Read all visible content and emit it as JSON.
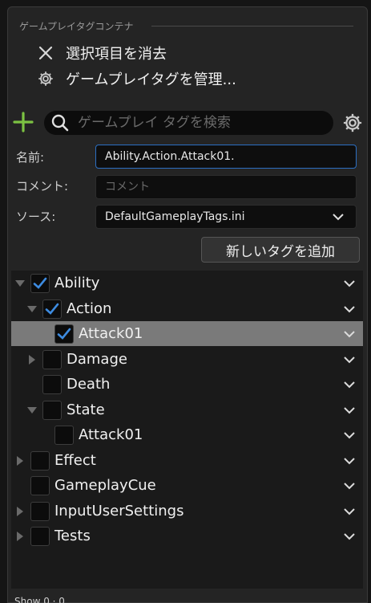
{
  "section": {
    "title": "ゲームプレイタグコンテナ"
  },
  "menu": {
    "clear_label": "選択項目を消去",
    "manage_label": "ゲームプレイタグを管理..."
  },
  "search": {
    "placeholder": "ゲームプレイ タグを検索",
    "value": ""
  },
  "form": {
    "name_label": "名前:",
    "name_value": "Ability.Action.Attack01.",
    "comment_label": "コメント:",
    "comment_placeholder": "コメント",
    "source_label": "ソース:",
    "source_value": "DefaultGameplayTags.ini"
  },
  "add_button_label": "新しいタグを追加",
  "tree": {
    "items": [
      {
        "label": "Ability",
        "depth": 0,
        "expand": "open",
        "checked": true,
        "selected": false
      },
      {
        "label": "Action",
        "depth": 1,
        "expand": "open",
        "checked": true,
        "selected": false
      },
      {
        "label": "Attack01",
        "depth": 2,
        "expand": "none",
        "checked": true,
        "selected": true
      },
      {
        "label": "Damage",
        "depth": 1,
        "expand": "closed",
        "checked": false,
        "selected": false
      },
      {
        "label": "Death",
        "depth": 1,
        "expand": "none",
        "checked": false,
        "selected": false
      },
      {
        "label": "State",
        "depth": 1,
        "expand": "open",
        "checked": false,
        "selected": false
      },
      {
        "label": "Attack01",
        "depth": 2,
        "expand": "none",
        "checked": false,
        "selected": false
      },
      {
        "label": "Effect",
        "depth": 0,
        "expand": "closed",
        "checked": false,
        "selected": false
      },
      {
        "label": "GameplayCue",
        "depth": 0,
        "expand": "none",
        "checked": false,
        "selected": false
      },
      {
        "label": "InputUserSettings",
        "depth": 0,
        "expand": "closed",
        "checked": false,
        "selected": false
      },
      {
        "label": "Tests",
        "depth": 0,
        "expand": "closed",
        "checked": false,
        "selected": false
      }
    ]
  },
  "status": {
    "text": "Show 0 · 0"
  },
  "colors": {
    "accent_plus": "#7cc242",
    "check_blue": "#3d8be0",
    "selected_row": "#7a7a7a",
    "field_focus_border": "#2c6fc2"
  },
  "icons": {
    "clear": "close-icon",
    "manage": "gear-icon",
    "add": "plus-icon",
    "search": "search-icon",
    "settings": "gear-icon",
    "dropdown": "chevron-down-icon"
  }
}
